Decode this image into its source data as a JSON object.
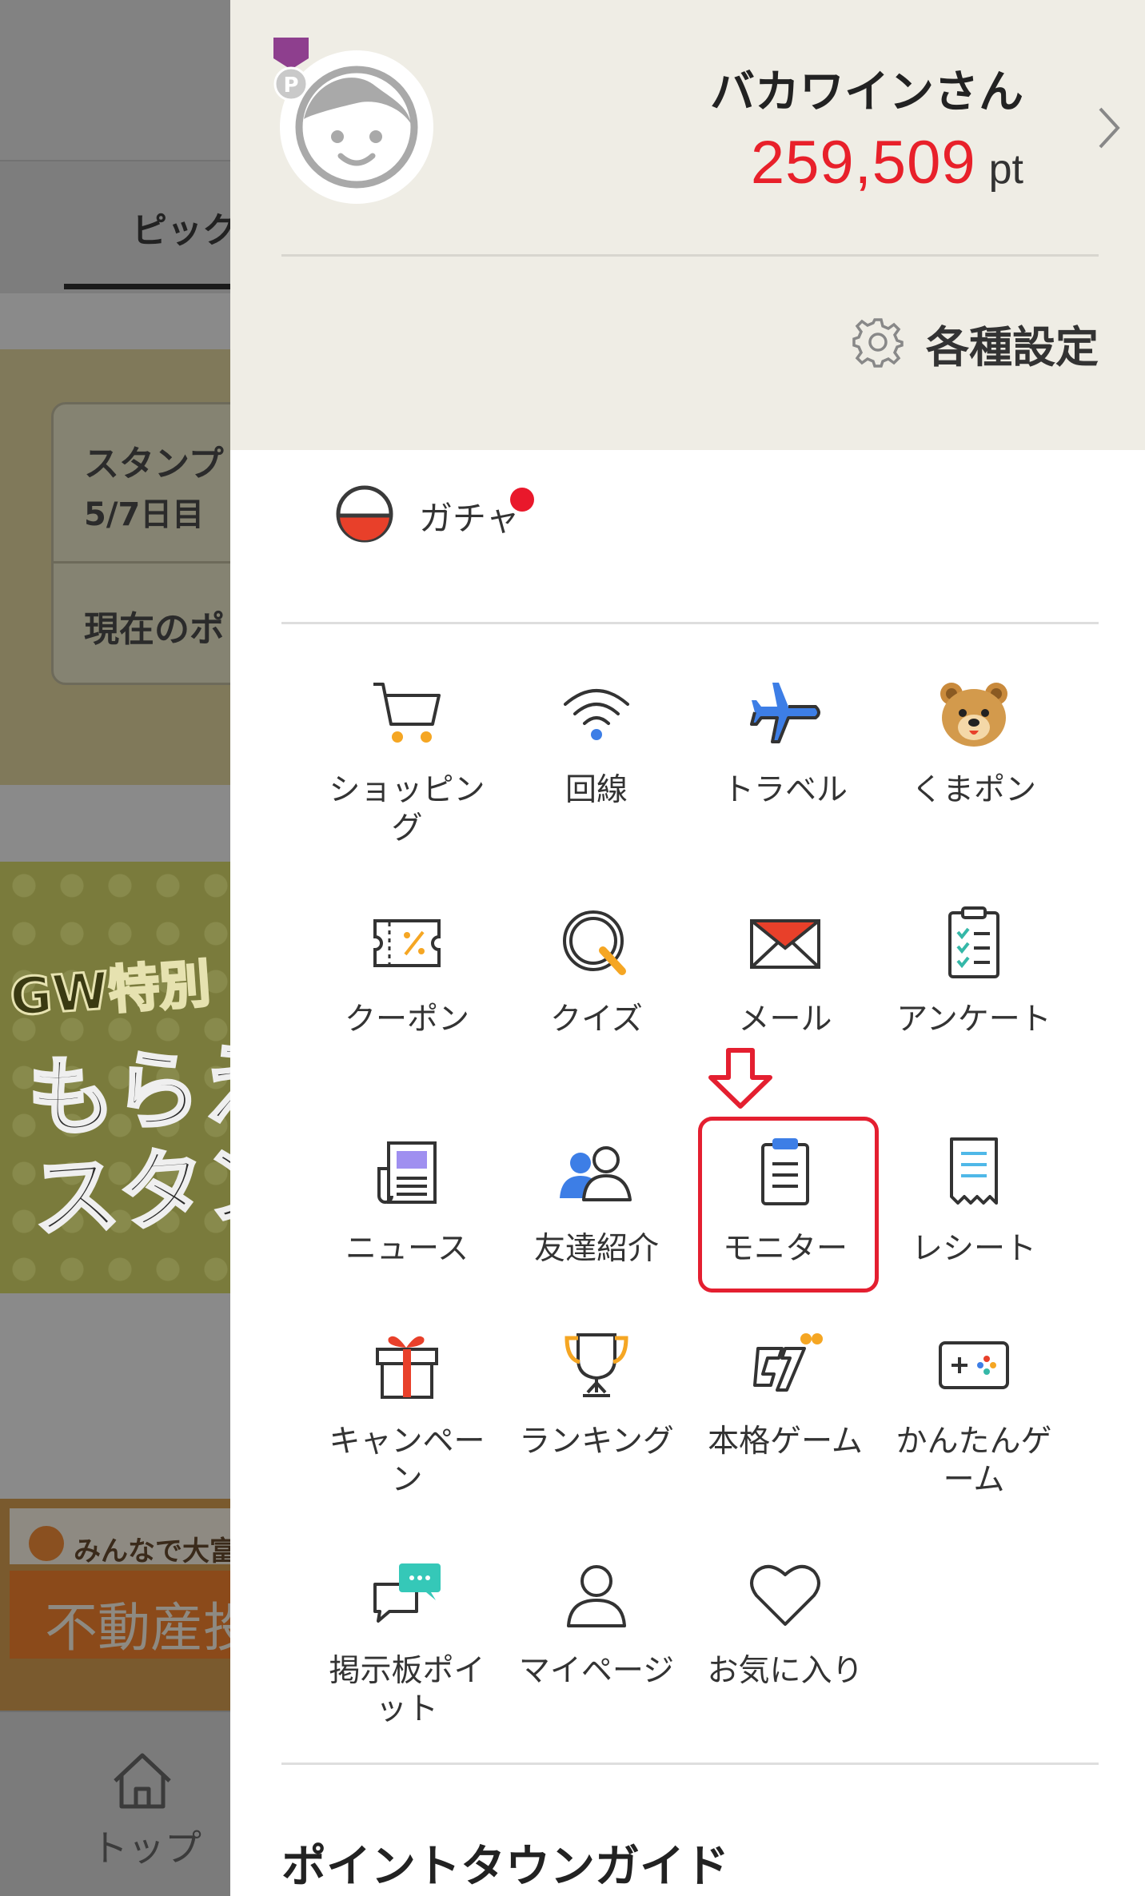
{
  "background_app": {
    "tab_label": "ピック",
    "stamp_card": {
      "title": "スタンプ",
      "day": "5/7日目",
      "points_label": "現在のポ"
    },
    "banner": {
      "line1": "GW特別",
      "line2": "もらえ",
      "line3": "スタン"
    },
    "ad": {
      "brand": "みんなで大富さ",
      "text": "不動産投"
    },
    "bottom_nav": {
      "top_label": "トップ"
    }
  },
  "drawer": {
    "profile": {
      "username": "バカワインさん",
      "points_value": "259,509",
      "points_unit": "pt",
      "medal_letter": "P"
    },
    "settings_label": "各種設定",
    "gacha": {
      "label": "ガチャ",
      "has_notification": true
    },
    "menu_items": [
      {
        "label": "ショッピング",
        "icon": "cart-icon"
      },
      {
        "label": "回線",
        "icon": "wifi-icon"
      },
      {
        "label": "トラベル",
        "icon": "airplane-icon"
      },
      {
        "label": "くまポン",
        "icon": "bear-icon"
      },
      {
        "label": "クーポン",
        "icon": "coupon-icon"
      },
      {
        "label": "クイズ",
        "icon": "quiz-icon"
      },
      {
        "label": "メール",
        "icon": "mail-icon"
      },
      {
        "label": "アンケート",
        "icon": "survey-icon"
      },
      {
        "label": "ニュース",
        "icon": "news-icon"
      },
      {
        "label": "友達紹介",
        "icon": "friends-icon"
      },
      {
        "label": "モニター",
        "icon": "monitor-icon"
      },
      {
        "label": "レシート",
        "icon": "receipt-icon"
      },
      {
        "label": "キャンペーン",
        "icon": "gift-icon"
      },
      {
        "label": "ランキング",
        "icon": "trophy-icon"
      },
      {
        "label": "本格ゲーム",
        "icon": "game-logo-icon"
      },
      {
        "label": "かんたんゲーム",
        "icon": "gamepad-icon"
      },
      {
        "label": "掲示板ポイット",
        "icon": "chat-icon"
      },
      {
        "label": "マイページ",
        "icon": "user-icon"
      },
      {
        "label": "お気に入り",
        "icon": "heart-icon"
      }
    ],
    "highlighted_item": "モニター",
    "section_title": "ポイントタウンガイド"
  },
  "colors": {
    "points": "#e8202a",
    "highlight": "#e41f30",
    "profile_bg": "#efede5",
    "accent_blue": "#3d7ee6",
    "accent_orange": "#f5a623"
  }
}
